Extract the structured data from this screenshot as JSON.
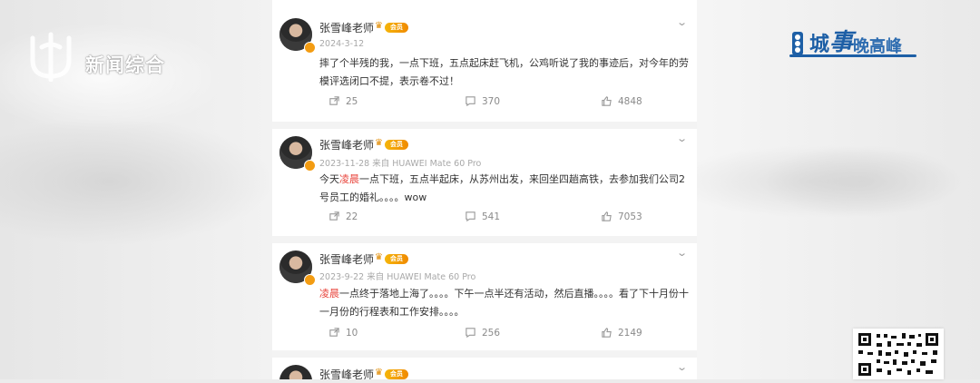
{
  "channel": {
    "name": "新闻综合"
  },
  "program": {
    "part1": "城",
    "part2": "事",
    "part3": "晚高峰"
  },
  "posts": [
    {
      "username": "张雪峰老师",
      "vip_label": "会员",
      "date": "2024-3-12",
      "source": "",
      "text": "摔了个半残的我，一点下班，五点起床赶飞机，公鸡听说了我的事迹后，对今年的劳模评选闭口不提，表示卷不过！",
      "reposts": "25",
      "comments": "370",
      "likes": "4848"
    },
    {
      "username": "张雪峰老师",
      "vip_label": "会员",
      "date": "2023-11-28",
      "source": "来自 HUAWEI Mate 60 Pro",
      "text_hl": "凌晨",
      "text_before": "今天",
      "text_after": "一点下班，五点半起床，从苏州出发，来回坐四趟高铁，去参加我们公司2号员工的婚礼。。。。wow",
      "reposts": "22",
      "comments": "541",
      "likes": "7053"
    },
    {
      "username": "张雪峰老师",
      "vip_label": "会员",
      "date": "2023-9-22",
      "source": "来自 HUAWEI Mate 60 Pro",
      "text_hl": "凌晨",
      "text_after": "一点终于落地上海了。。。。下午一点半还有活动，然后直播。。。。看了下十月份十一月份的行程表和工作安排。。。。",
      "reposts": "10",
      "comments": "256",
      "likes": "2149"
    },
    {
      "username": "张雪峰老师",
      "vip_label": "会员"
    }
  ],
  "icons": {
    "repost": "repost-icon",
    "comment": "comment-icon",
    "like": "like-icon",
    "more": "chevron-down-icon"
  },
  "colors": {
    "highlight": "#e8453c",
    "vip": "#f5b50a",
    "program": "#1d5fa6"
  }
}
